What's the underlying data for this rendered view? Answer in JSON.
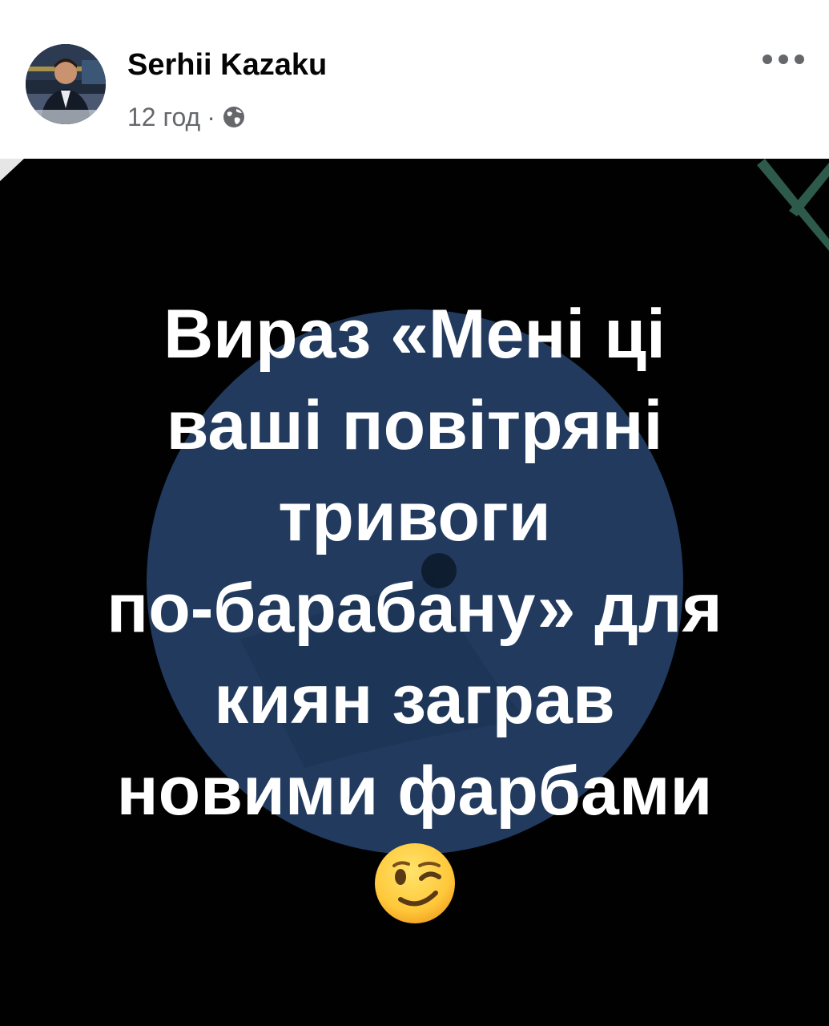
{
  "post": {
    "author": "Serhii Kazaku",
    "time": "12 год",
    "separator": "·",
    "privacy_icon": "globe-icon",
    "more_icon": "more-options-icon"
  },
  "image": {
    "caption_lines": [
      "Вираз «Мені ці",
      "ваші повітряні",
      "тривоги",
      "по-барабану» для",
      "киян заграв",
      "новими фарбами"
    ],
    "emoji": "winking-face-emoji",
    "colors": {
      "background": "#010101",
      "circle": "#213a5e",
      "accent": "#2e5a4c",
      "text": "#ffffff"
    }
  }
}
